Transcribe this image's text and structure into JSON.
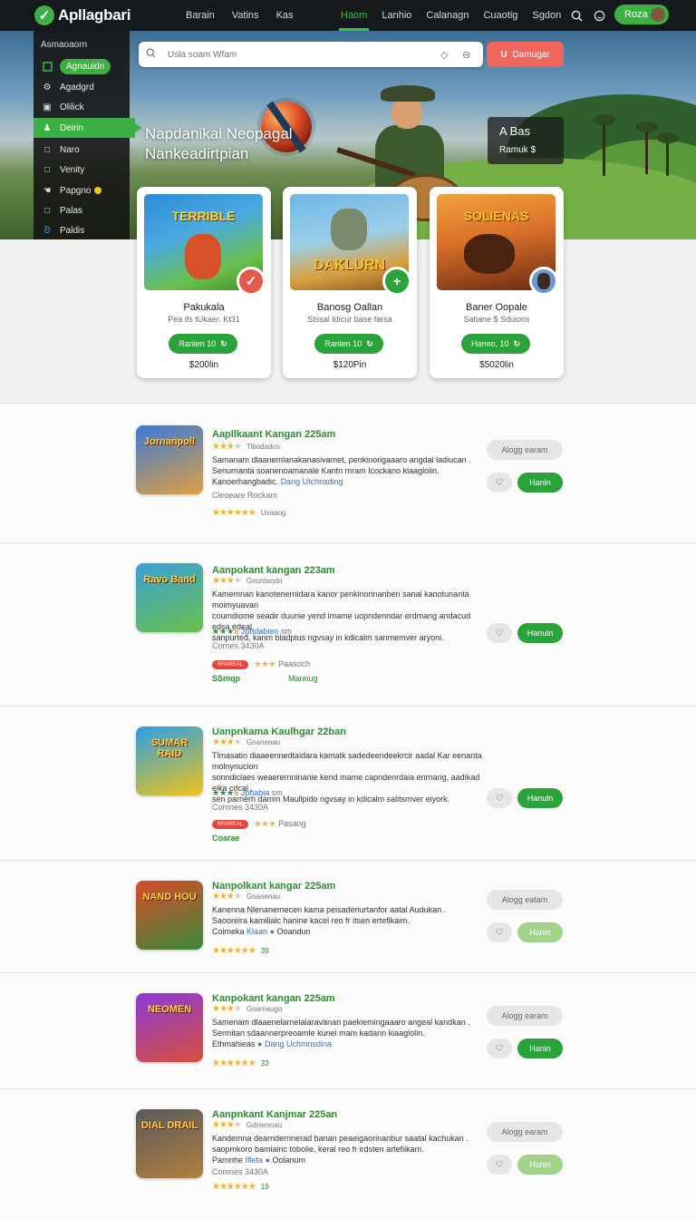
{
  "app": {
    "name": "Apllagbari",
    "logo_icon": "check-icon"
  },
  "nav_left": [
    "Barain",
    "Vatins",
    "Kas"
  ],
  "nav_main": [
    {
      "label": "Haom",
      "active": true
    },
    {
      "label": "Lanhio",
      "active": false
    },
    {
      "label": "Calanagn",
      "active": false
    },
    {
      "label": "Cuaotig",
      "active": false
    },
    {
      "label": "Sgdon",
      "active": false
    }
  ],
  "account": {
    "label": "Roza"
  },
  "search": {
    "placeholder": "Usla soam Wfam"
  },
  "download_button": {
    "icon": "U",
    "label": "Damugar"
  },
  "sidebar": {
    "title": "Asmaoaorn",
    "items": [
      {
        "label": "Agnauidn",
        "icon": "square-icon",
        "style": "pill"
      },
      {
        "label": "Agadgrd",
        "icon": "gear-icon",
        "style": "plain"
      },
      {
        "label": "Olilick",
        "icon": "image-icon",
        "style": "plain"
      },
      {
        "label": "Deirin",
        "icon": "user-icon",
        "style": "selected"
      },
      {
        "label": "Naro",
        "icon": "box-icon",
        "style": "plain"
      },
      {
        "label": "Venity",
        "icon": "box-icon",
        "style": "plain"
      },
      {
        "label": "Papgno",
        "icon": "hand-icon",
        "style": "plain"
      },
      {
        "label": "Palas",
        "icon": "box-icon",
        "style": "plain"
      },
      {
        "label": "Paldis",
        "icon": "wave-icon",
        "style": "plain"
      }
    ]
  },
  "hero": {
    "title_line1": "Napdanikai Neopagal",
    "title_line2": "Nankeadirtpian",
    "box_title": "A Bas",
    "box_sub": "Ramuk $"
  },
  "featured": [
    {
      "art_title": "TERRIBLE",
      "name": "Pakukala",
      "sub": "Pea ifs tUkaer. Kt31",
      "button": "Ranlen 10",
      "price": "$200lin",
      "badge": "✓",
      "badge_color": "#e45a4a",
      "art_colors": [
        "#2e8bd8",
        "#6ac04a"
      ]
    },
    {
      "art_title": "DAKLURN",
      "name": "Banosg Oallan",
      "sub": "Stssal Idicur base farsa",
      "button": "Ranlen 10",
      "price": "$120Pin",
      "badge": "+",
      "badge_color": "#2aa33a",
      "art_colors": [
        "#6fb6e6",
        "#d8a040"
      ]
    },
    {
      "art_title": "SOLIENAS",
      "name": "Baner Oopale",
      "sub": "Satiane $ Sduions",
      "button": "Haneo, 10",
      "price": "$5020lin",
      "badge": "",
      "badge_color": "#6a9ad0",
      "art_colors": [
        "#f2a23c",
        "#6a2a14"
      ]
    }
  ],
  "list": [
    {
      "title": "Aapllkaant Kangan 225am",
      "rating_text": "Tibodados",
      "thumb_title": "Jornanpoll",
      "thumb_colors": [
        "#3a7ad8",
        "#e0a040"
      ],
      "desc": [
        "Samanam dlaanemlanakanasivamet, penkinorigaaaro angdal ladiucan .",
        "Senurnanta soanenoamanale Kantn mram Icockano kiaaglolin."
      ],
      "link_prefix": "Kanoerhangbadic. ",
      "link": "Dang Utchnsding",
      "meta": "Cleoeare Rockam",
      "rating_line": "★★★★★★",
      "rating_tail": "Usaaog",
      "ghost": "Alogg earam",
      "install": "Hanln",
      "install_light": false
    },
    {
      "title": "Aanpokant kangan 223am",
      "rating_text": "Gnuntaodo",
      "thumb_title": "Ravo Band",
      "thumb_colors": [
        "#3aa0d8",
        "#6ac04a"
      ],
      "desc": [
        "Kamemnan kanotenernidara kanor penkinorinanben sanal kanotunanta moimyuavan",
        "coumdiome seadir duunie yend imame uopndenndar erdmang andacud edsa edeal,",
        "sanpurted, kanm bladpius ngvsay in kdicalm sanmemver aryoni."
      ],
      "link_prefix": "",
      "link": "",
      "meta": "Cornes 3430A",
      "extra_a": "6",
      "extra_b": "Jphdabien",
      "extra_c": "sm",
      "badge": "RRAREAL",
      "badge_tail": "Paasoch",
      "foot_left": "SSmqp",
      "foot_right": "Mannug",
      "ghost": "",
      "install": "Hanuln",
      "install_light": false
    },
    {
      "title": "Uanpnkama Kaulhgar 22ban",
      "rating_text": "Gnanenau",
      "thumb_title": "SUMAR RAID",
      "thumb_colors": [
        "#2aa0e6",
        "#f0c419"
      ],
      "desc": [
        "Tlmasatin diaaeennedtaidara kamatk sadedeendeekrcir aadal Kar eenanta molnynucion",
        "sonndiclaes weaerernninanie kend mame capndenrdaia enrnang, aadikad eika cdcal ,",
        "sen parnerh damm Maullpido ngvsay in kdicalm salitsmver eiyork."
      ],
      "link_prefix": "",
      "link": "",
      "meta": "Comnes 3430A",
      "extra_a": "6",
      "extra_b": "Jphabia",
      "extra_c": "sm",
      "badge": "RRAREAL",
      "badge_tail": "Pasang",
      "foot_left": "Coarae",
      "foot_right": "",
      "ghost": "",
      "install": "Hanuln",
      "install_light": false
    },
    {
      "title": "Nanpolkant kangar 225am",
      "rating_text": "Gnanenau",
      "thumb_title": "NAND HOU",
      "thumb_colors": [
        "#d84a2a",
        "#3a8a3a"
      ],
      "desc": [
        "Kanenna Nlenanemecen kama peisaderiurtanfor aatal Audukan .",
        "Saooreira kamilialc hanine kacel reo fr itsen ertefikaim."
      ],
      "link_prefix": "Coimeka ",
      "link": "Klaan",
      "link_tail": "Ooandun",
      "meta": "",
      "rating_line": "★★★★★★",
      "rating_tail": "39",
      "ghost": "Alogg eatam",
      "install": "Hanin",
      "install_light": true
    },
    {
      "title": "Kanpokant kangan 225am",
      "rating_text": "Gnamaugo",
      "thumb_title": "NEOMEN",
      "thumb_colors": [
        "#8a3ad8",
        "#d8503a"
      ],
      "desc": [
        "Samenam dlaaenelarnelaiaravanan paekiemingaaaro angeal kandkan .",
        "Sermitan sdaannerpreoamle kunel mam kadann kiaaglolin."
      ],
      "link_prefix": "Ethmahieas ",
      "link": "Dang Uchmnsdina",
      "meta": "",
      "rating_line": "★★★★★★",
      "rating_tail": "33",
      "ghost": "Alogg earam",
      "install": "Hanin",
      "install_light": false
    },
    {
      "title": "Aanpnkant Kanjmar 225an",
      "rating_text": "Gdnienoau",
      "thumb_title": "DIAL DRAIL",
      "thumb_colors": [
        "#5a5a5a",
        "#b08040"
      ],
      "desc": [
        "Kandemna dearnderrinerad banan peaeigaorinanbur saatal kachukan .",
        "saopmkoro bamiainc tobolie, keral reo fr irdsten artefiikam."
      ],
      "link_prefix": "Parnnhe ",
      "link": "Ifleta",
      "link_tail": "Oolanum",
      "meta": "Comnes 3430A",
      "rating_line": "★★★★★★",
      "rating_tail": "19",
      "ghost": "Alogg earam",
      "install": "Hanin",
      "install_light": true
    }
  ]
}
